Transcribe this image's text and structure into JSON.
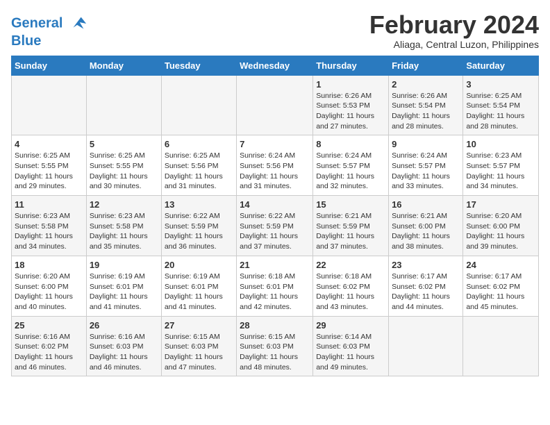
{
  "logo": {
    "line1": "General",
    "line2": "Blue"
  },
  "title": "February 2024",
  "subtitle": "Aliaga, Central Luzon, Philippines",
  "days_header": [
    "Sunday",
    "Monday",
    "Tuesday",
    "Wednesday",
    "Thursday",
    "Friday",
    "Saturday"
  ],
  "weeks": [
    [
      {
        "day": "",
        "info": ""
      },
      {
        "day": "",
        "info": ""
      },
      {
        "day": "",
        "info": ""
      },
      {
        "day": "",
        "info": ""
      },
      {
        "day": "1",
        "info": "Sunrise: 6:26 AM\nSunset: 5:53 PM\nDaylight: 11 hours and 27 minutes."
      },
      {
        "day": "2",
        "info": "Sunrise: 6:26 AM\nSunset: 5:54 PM\nDaylight: 11 hours and 28 minutes."
      },
      {
        "day": "3",
        "info": "Sunrise: 6:25 AM\nSunset: 5:54 PM\nDaylight: 11 hours and 28 minutes."
      }
    ],
    [
      {
        "day": "4",
        "info": "Sunrise: 6:25 AM\nSunset: 5:55 PM\nDaylight: 11 hours and 29 minutes."
      },
      {
        "day": "5",
        "info": "Sunrise: 6:25 AM\nSunset: 5:55 PM\nDaylight: 11 hours and 30 minutes."
      },
      {
        "day": "6",
        "info": "Sunrise: 6:25 AM\nSunset: 5:56 PM\nDaylight: 11 hours and 31 minutes."
      },
      {
        "day": "7",
        "info": "Sunrise: 6:24 AM\nSunset: 5:56 PM\nDaylight: 11 hours and 31 minutes."
      },
      {
        "day": "8",
        "info": "Sunrise: 6:24 AM\nSunset: 5:57 PM\nDaylight: 11 hours and 32 minutes."
      },
      {
        "day": "9",
        "info": "Sunrise: 6:24 AM\nSunset: 5:57 PM\nDaylight: 11 hours and 33 minutes."
      },
      {
        "day": "10",
        "info": "Sunrise: 6:23 AM\nSunset: 5:57 PM\nDaylight: 11 hours and 34 minutes."
      }
    ],
    [
      {
        "day": "11",
        "info": "Sunrise: 6:23 AM\nSunset: 5:58 PM\nDaylight: 11 hours and 34 minutes."
      },
      {
        "day": "12",
        "info": "Sunrise: 6:23 AM\nSunset: 5:58 PM\nDaylight: 11 hours and 35 minutes."
      },
      {
        "day": "13",
        "info": "Sunrise: 6:22 AM\nSunset: 5:59 PM\nDaylight: 11 hours and 36 minutes."
      },
      {
        "day": "14",
        "info": "Sunrise: 6:22 AM\nSunset: 5:59 PM\nDaylight: 11 hours and 37 minutes."
      },
      {
        "day": "15",
        "info": "Sunrise: 6:21 AM\nSunset: 5:59 PM\nDaylight: 11 hours and 37 minutes."
      },
      {
        "day": "16",
        "info": "Sunrise: 6:21 AM\nSunset: 6:00 PM\nDaylight: 11 hours and 38 minutes."
      },
      {
        "day": "17",
        "info": "Sunrise: 6:20 AM\nSunset: 6:00 PM\nDaylight: 11 hours and 39 minutes."
      }
    ],
    [
      {
        "day": "18",
        "info": "Sunrise: 6:20 AM\nSunset: 6:00 PM\nDaylight: 11 hours and 40 minutes."
      },
      {
        "day": "19",
        "info": "Sunrise: 6:19 AM\nSunset: 6:01 PM\nDaylight: 11 hours and 41 minutes."
      },
      {
        "day": "20",
        "info": "Sunrise: 6:19 AM\nSunset: 6:01 PM\nDaylight: 11 hours and 41 minutes."
      },
      {
        "day": "21",
        "info": "Sunrise: 6:18 AM\nSunset: 6:01 PM\nDaylight: 11 hours and 42 minutes."
      },
      {
        "day": "22",
        "info": "Sunrise: 6:18 AM\nSunset: 6:02 PM\nDaylight: 11 hours and 43 minutes."
      },
      {
        "day": "23",
        "info": "Sunrise: 6:17 AM\nSunset: 6:02 PM\nDaylight: 11 hours and 44 minutes."
      },
      {
        "day": "24",
        "info": "Sunrise: 6:17 AM\nSunset: 6:02 PM\nDaylight: 11 hours and 45 minutes."
      }
    ],
    [
      {
        "day": "25",
        "info": "Sunrise: 6:16 AM\nSunset: 6:02 PM\nDaylight: 11 hours and 46 minutes."
      },
      {
        "day": "26",
        "info": "Sunrise: 6:16 AM\nSunset: 6:03 PM\nDaylight: 11 hours and 46 minutes."
      },
      {
        "day": "27",
        "info": "Sunrise: 6:15 AM\nSunset: 6:03 PM\nDaylight: 11 hours and 47 minutes."
      },
      {
        "day": "28",
        "info": "Sunrise: 6:15 AM\nSunset: 6:03 PM\nDaylight: 11 hours and 48 minutes."
      },
      {
        "day": "29",
        "info": "Sunrise: 6:14 AM\nSunset: 6:03 PM\nDaylight: 11 hours and 49 minutes."
      },
      {
        "day": "",
        "info": ""
      },
      {
        "day": "",
        "info": ""
      }
    ]
  ]
}
